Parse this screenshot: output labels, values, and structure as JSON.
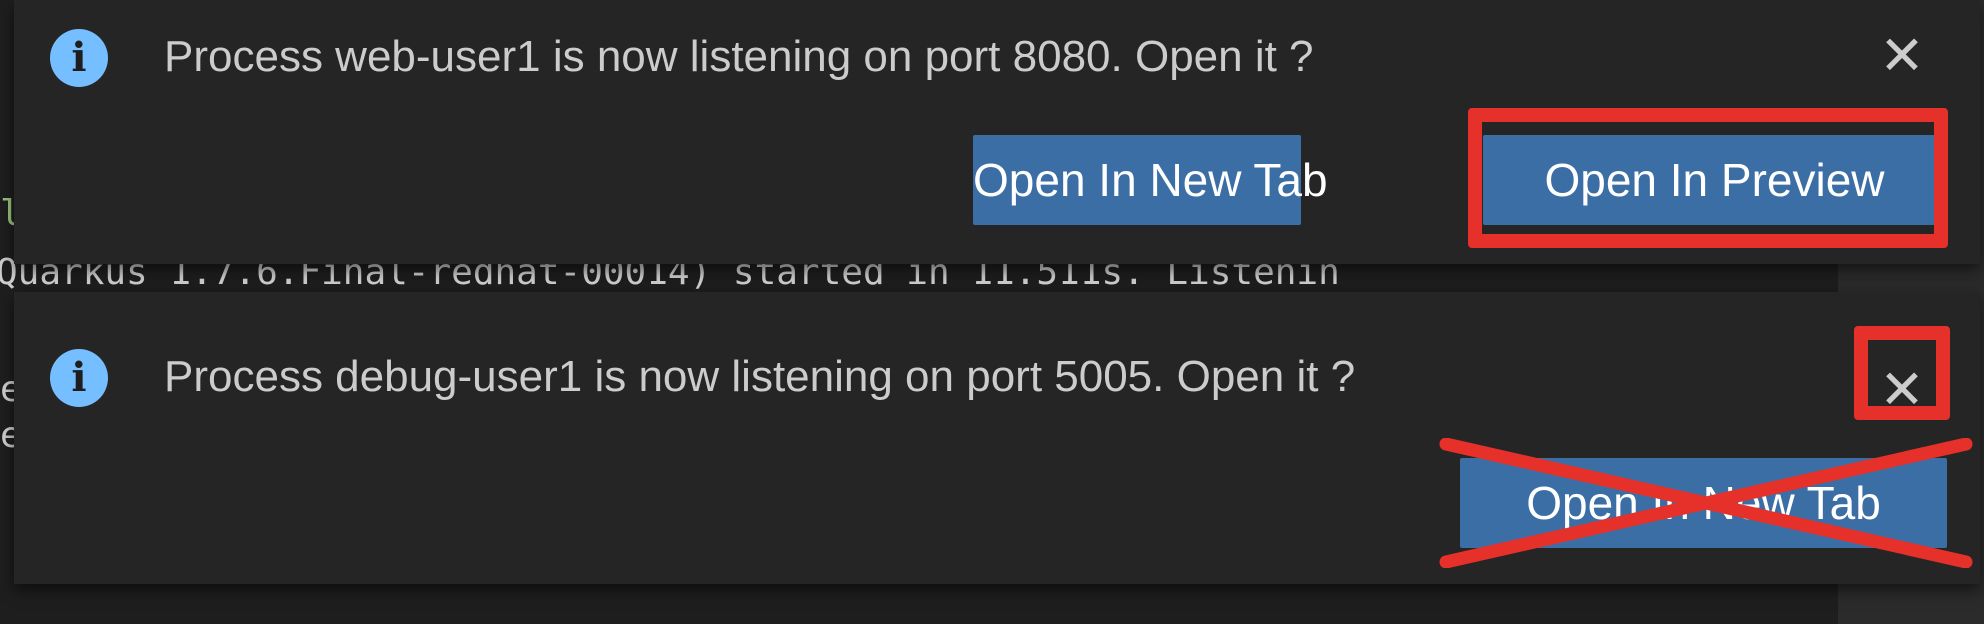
{
  "background_terminal": {
    "line_l": "l",
    "line_quarkus": "Quarkus 1.7.6.Final-redhat-00014) started in 11.511s. Listenin",
    "line_e1": "e",
    "line_e2": "e"
  },
  "notifications": [
    {
      "icon": "info-icon",
      "message": "Process web-user1 is now listening on port 8080. Open it ?",
      "close_glyph": "✕",
      "actions": [
        {
          "label": "Open In New Tab"
        },
        {
          "label": "Open In Preview"
        }
      ]
    },
    {
      "icon": "info-icon",
      "message": "Process debug-user1 is now listening on port 5005. Open it ?",
      "close_glyph": "✕",
      "actions": [
        {
          "label": "Open In New Tab"
        }
      ]
    }
  ],
  "icon_glyph": "i",
  "colors": {
    "toast_background": "#252526",
    "button_primary": "#3c6ea6",
    "info_icon": "#75beff",
    "annotation_red": "#e53129"
  }
}
